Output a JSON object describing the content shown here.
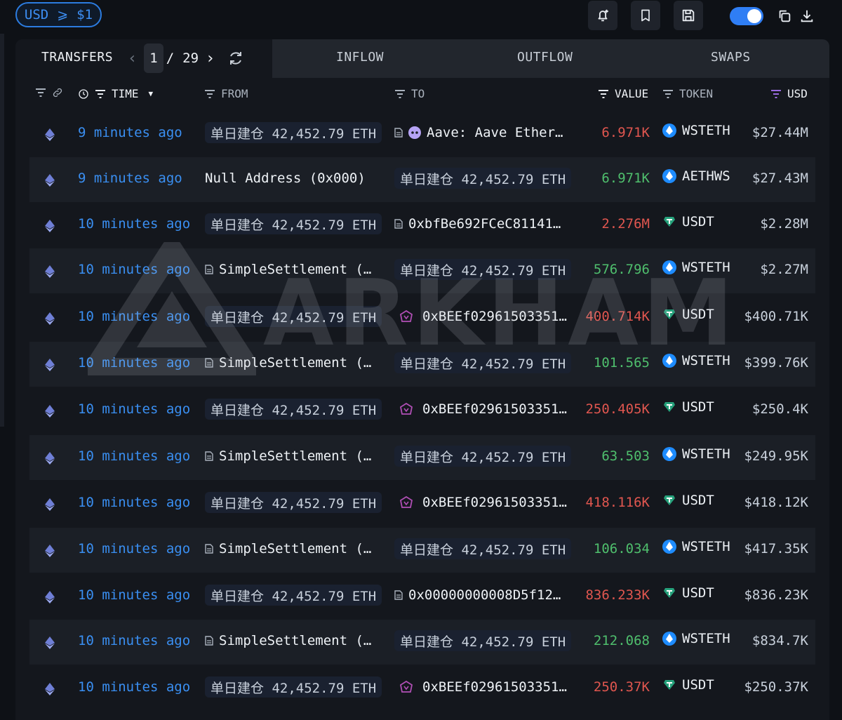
{
  "toolbar": {
    "usd_filter_label": "USD",
    "usd_filter_op": "⩾",
    "usd_filter_value": "$1"
  },
  "tabs": {
    "transfers": "TRANSFERS",
    "page_current": "1",
    "page_sep": "/",
    "page_total": "29",
    "inflow": "INFLOW",
    "outflow": "OUTFLOW",
    "swaps": "SWAPS"
  },
  "columns": {
    "time": "TIME",
    "from": "FROM",
    "to": "TO",
    "value": "VALUE",
    "token": "TOKEN",
    "usd": "USD"
  },
  "watermark": "ARKHAM",
  "colors": {
    "accent_blue": "#2f7ef4",
    "value_outflow": "#e0564f",
    "value_inflow": "#4fbf6d",
    "wsteth_icon": "#1e8cff",
    "usdt_icon": "#26a17b"
  },
  "rows": [
    {
      "time": "9 minutes ago",
      "from": "单日建仓 42,452.79 ETH",
      "from_pill": true,
      "from_doc": false,
      "to": "Aave: Aave Ether…",
      "to_pill": false,
      "to_icon": "aave-icon",
      "value": "6.971K",
      "dir": "red",
      "token": "WSTETH",
      "token_icon": "wsteth-icon",
      "usd": "$27.44M"
    },
    {
      "time": "9 minutes ago",
      "from": "Null Address (0x000)",
      "from_pill": false,
      "from_doc": false,
      "to": "单日建仓 42,452.79 ETH",
      "to_pill": true,
      "to_icon": "",
      "value": "6.971K",
      "dir": "green",
      "token": "AETHWS",
      "token_icon": "wsteth-icon",
      "usd": "$27.43M"
    },
    {
      "time": "10 minutes ago",
      "from": "单日建仓 42,452.79 ETH",
      "from_pill": true,
      "from_doc": false,
      "to": "0xbfBe692FCeC81141…",
      "to_pill": false,
      "to_icon": "doc-icon",
      "value": "2.276M",
      "dir": "red",
      "token": "USDT",
      "token_icon": "usdt-icon",
      "usd": "$2.28M"
    },
    {
      "time": "10 minutes ago",
      "from": "SimpleSettlement (…",
      "from_pill": false,
      "from_doc": true,
      "to": "单日建仓 42,452.79 ETH",
      "to_pill": true,
      "to_icon": "",
      "value": "576.796",
      "dir": "green",
      "token": "WSTETH",
      "token_icon": "wsteth-icon",
      "usd": "$2.27M"
    },
    {
      "time": "10 minutes ago",
      "from": "单日建仓 42,452.79 ETH",
      "from_pill": true,
      "from_doc": false,
      "to": "0xBEEf02961503351…",
      "to_pill": false,
      "to_icon": "beef-icon",
      "value": "400.714K",
      "dir": "red",
      "token": "USDT",
      "token_icon": "usdt-icon",
      "usd": "$400.71K"
    },
    {
      "time": "10 minutes ago",
      "from": "SimpleSettlement (…",
      "from_pill": false,
      "from_doc": true,
      "to": "单日建仓 42,452.79 ETH",
      "to_pill": true,
      "to_icon": "",
      "value": "101.565",
      "dir": "green",
      "token": "WSTETH",
      "token_icon": "wsteth-icon",
      "usd": "$399.76K"
    },
    {
      "time": "10 minutes ago",
      "from": "单日建仓 42,452.79 ETH",
      "from_pill": true,
      "from_doc": false,
      "to": "0xBEEf02961503351…",
      "to_pill": false,
      "to_icon": "beef-icon",
      "value": "250.405K",
      "dir": "red",
      "token": "USDT",
      "token_icon": "usdt-icon",
      "usd": "$250.4K"
    },
    {
      "time": "10 minutes ago",
      "from": "SimpleSettlement (…",
      "from_pill": false,
      "from_doc": true,
      "to": "单日建仓 42,452.79 ETH",
      "to_pill": true,
      "to_icon": "",
      "value": "63.503",
      "dir": "green",
      "token": "WSTETH",
      "token_icon": "wsteth-icon",
      "usd": "$249.95K"
    },
    {
      "time": "10 minutes ago",
      "from": "单日建仓 42,452.79 ETH",
      "from_pill": true,
      "from_doc": false,
      "to": "0xBEEf02961503351…",
      "to_pill": false,
      "to_icon": "beef-icon",
      "value": "418.116K",
      "dir": "red",
      "token": "USDT",
      "token_icon": "usdt-icon",
      "usd": "$418.12K"
    },
    {
      "time": "10 minutes ago",
      "from": "SimpleSettlement (…",
      "from_pill": false,
      "from_doc": true,
      "to": "单日建仓 42,452.79 ETH",
      "to_pill": true,
      "to_icon": "",
      "value": "106.034",
      "dir": "green",
      "token": "WSTETH",
      "token_icon": "wsteth-icon",
      "usd": "$417.35K"
    },
    {
      "time": "10 minutes ago",
      "from": "单日建仓 42,452.79 ETH",
      "from_pill": true,
      "from_doc": false,
      "to": "0x00000000008D5f12…",
      "to_pill": false,
      "to_icon": "doc-icon",
      "value": "836.233K",
      "dir": "red",
      "token": "USDT",
      "token_icon": "usdt-icon",
      "usd": "$836.23K"
    },
    {
      "time": "10 minutes ago",
      "from": "SimpleSettlement (…",
      "from_pill": false,
      "from_doc": true,
      "to": "单日建仓 42,452.79 ETH",
      "to_pill": true,
      "to_icon": "",
      "value": "212.068",
      "dir": "green",
      "token": "WSTETH",
      "token_icon": "wsteth-icon",
      "usd": "$834.7K"
    },
    {
      "time": "10 minutes ago",
      "from": "单日建仓 42,452.79 ETH",
      "from_pill": true,
      "from_doc": false,
      "to": "0xBEEf02961503351…",
      "to_pill": false,
      "to_icon": "beef-icon",
      "value": "250.37K",
      "dir": "red",
      "token": "USDT",
      "token_icon": "usdt-icon",
      "usd": "$250.37K"
    }
  ]
}
